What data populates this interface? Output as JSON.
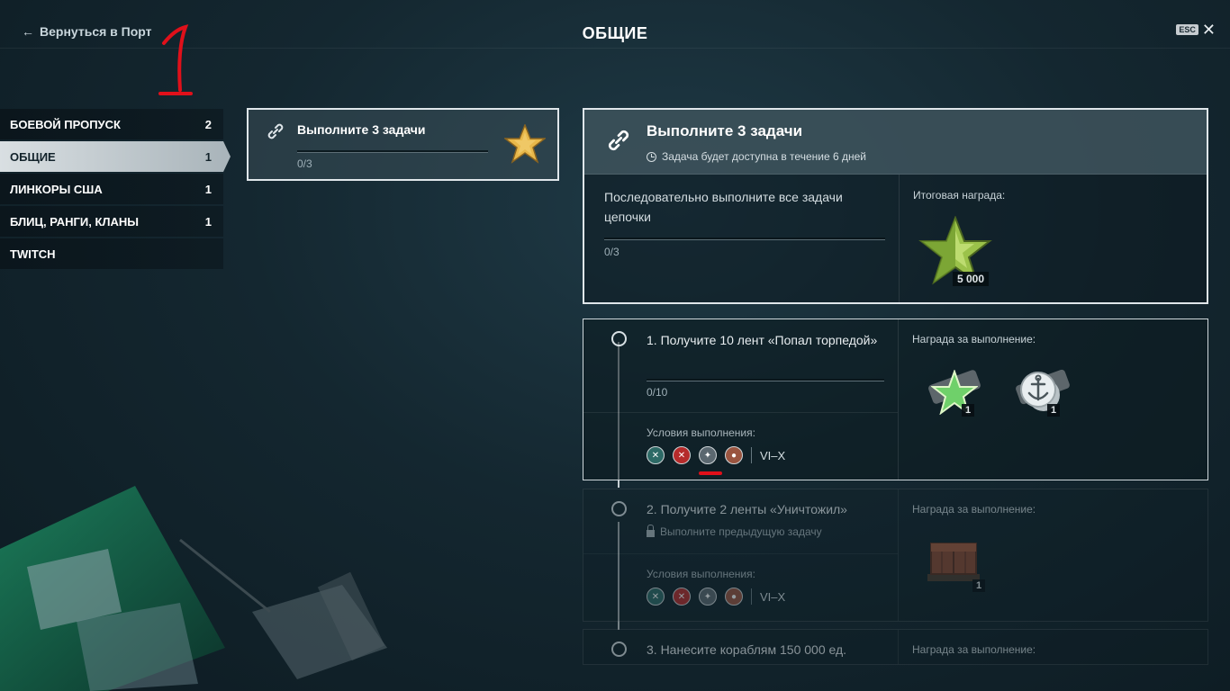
{
  "header": {
    "back_label": "Вернуться в Порт",
    "title": "ОБЩИЕ",
    "esc_label": "ESC",
    "close_glyph": "✕",
    "annotation_mark": "1"
  },
  "sidebar": {
    "items": [
      {
        "label": "БОЕВОЙ ПРОПУСК",
        "count": "2"
      },
      {
        "label": "ОБЩИЕ",
        "count": "1"
      },
      {
        "label": "ЛИНКОРЫ США",
        "count": "1"
      },
      {
        "label": "БЛИЦ, РАНГИ, КЛАНЫ",
        "count": "1"
      },
      {
        "label": "TWITCH",
        "count": ""
      }
    ],
    "active_index": 1
  },
  "chain_card": {
    "title": "Выполните 3 задачи",
    "progress": "0/3",
    "progress_fraction": 0
  },
  "detail": {
    "title": "Выполните 3 задачи",
    "subtitle": "Задача будет доступна в течение 6 дней",
    "description": "Последовательно выполните все задачи цепочки",
    "progress": "0/3",
    "progress_fraction": 0,
    "reward_label": "Итоговая награда:",
    "reward_amount": "5 000"
  },
  "tasks": [
    {
      "title": "1. Получите 10 лент «Попал торпедой»",
      "progress": "0/10",
      "progress_fraction": 0,
      "conditions_label": "Условия выполнения:",
      "tiers": "VI–X",
      "reward_label": "Награда за выполнение:",
      "rewards": [
        {
          "icon": "star-reward-icon",
          "count": "1"
        },
        {
          "icon": "anchor-coin-reward-icon",
          "count": "1"
        }
      ]
    },
    {
      "title": "2. Получите 2 ленты «Уничтожил»",
      "locked_text": "Выполните предыдущую задачу",
      "conditions_label": "Условия выполнения:",
      "tiers": "VI–X",
      "reward_label": "Награда за выполнение:",
      "rewards": [
        {
          "icon": "container-reward-icon",
          "count": "1"
        }
      ]
    },
    {
      "title": "3. Нанесите кораблям 150 000 ед.",
      "reward_label": "Награда за выполнение:"
    }
  ],
  "colors": {
    "background": "#142730",
    "panel_border": "#dfe6ea",
    "active_tab": "#d9dfe2",
    "annotation_red": "#e0101a",
    "star_gold": "#e8b84a",
    "star_green": "#9bc24a"
  }
}
